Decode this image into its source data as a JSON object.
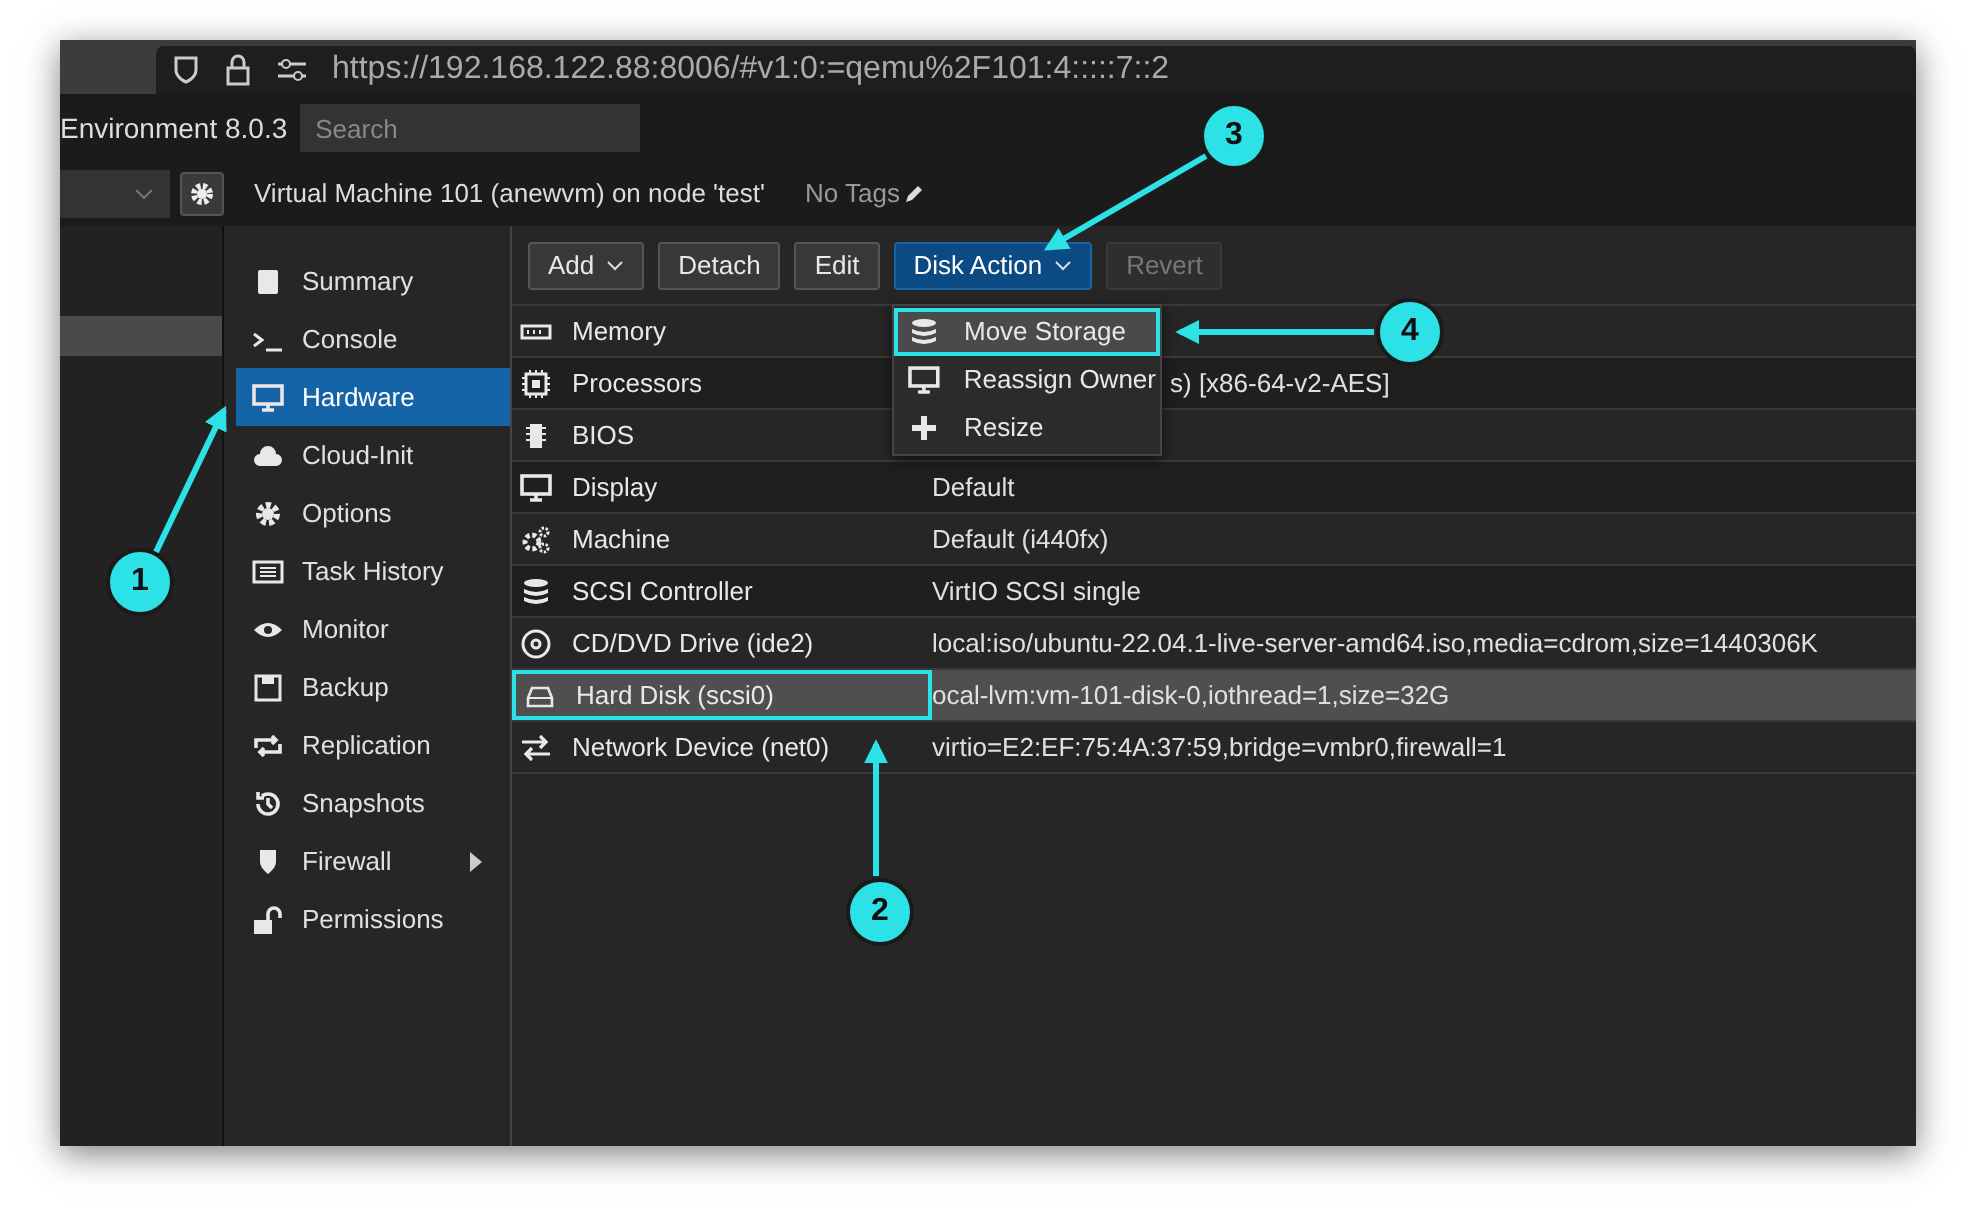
{
  "browser": {
    "url": "https://192.168.122.88:8006/#v1:0:=qemu%2F101:4:::::7::2"
  },
  "header": {
    "product": "Environment 8.0.3",
    "search": {
      "placeholder": "Search"
    }
  },
  "vm_title": "Virtual Machine 101 (anewvm) on node 'test'",
  "tags": "No Tags",
  "nav": [
    {
      "label": "Summary",
      "selected": false
    },
    {
      "label": "Console",
      "selected": false
    },
    {
      "label": "Hardware",
      "selected": true
    },
    {
      "label": "Cloud-Init",
      "selected": false
    },
    {
      "label": "Options",
      "selected": false
    },
    {
      "label": "Task History",
      "selected": false
    },
    {
      "label": "Monitor",
      "selected": false
    },
    {
      "label": "Backup",
      "selected": false
    },
    {
      "label": "Replication",
      "selected": false
    },
    {
      "label": "Snapshots",
      "selected": false
    },
    {
      "label": "Firewall",
      "selected": false,
      "has_submenu": true
    },
    {
      "label": "Permissions",
      "selected": false
    }
  ],
  "toolbar": [
    {
      "label": "Add",
      "kind": "menu"
    },
    {
      "label": "Detach",
      "kind": "plain"
    },
    {
      "label": "Edit",
      "kind": "plain"
    },
    {
      "label": "Disk Action",
      "kind": "active-menu"
    },
    {
      "label": "Revert",
      "kind": "disabled"
    }
  ],
  "disk_action_menu": [
    {
      "label": "Move Storage",
      "selected": true
    },
    {
      "label": "Reassign Owner",
      "selected": false
    },
    {
      "label": "Resize",
      "selected": false
    }
  ],
  "hardware": [
    {
      "name": "Memory",
      "selected": false
    },
    {
      "name": "Processors",
      "value": "s) [x86-64-v2-AES]",
      "selected": false
    },
    {
      "name": "BIOS",
      "selected": false
    },
    {
      "name": "Display",
      "value": "Default",
      "selected": false
    },
    {
      "name": "Machine",
      "value": "Default (i440fx)",
      "selected": false
    },
    {
      "name": "SCSI Controller",
      "value": "VirtIO SCSI single",
      "selected": false
    },
    {
      "name": "CD/DVD Drive (ide2)",
      "value": "local:iso/ubuntu-22.04.1-live-server-amd64.iso,media=cdrom,size=1440306K",
      "selected": false
    },
    {
      "name": "Hard Disk (scsi0)",
      "value": "ocal-lvm:vm-101-disk-0,iothread=1,size=32G",
      "selected": true
    },
    {
      "name": "Network Device (net0)",
      "value": "virtio=E2:EF:75:4A:37:59,bridge=vmbr0,firewall=1",
      "selected": false
    }
  ],
  "callouts": [
    "1",
    "2",
    "3",
    "4"
  ]
}
